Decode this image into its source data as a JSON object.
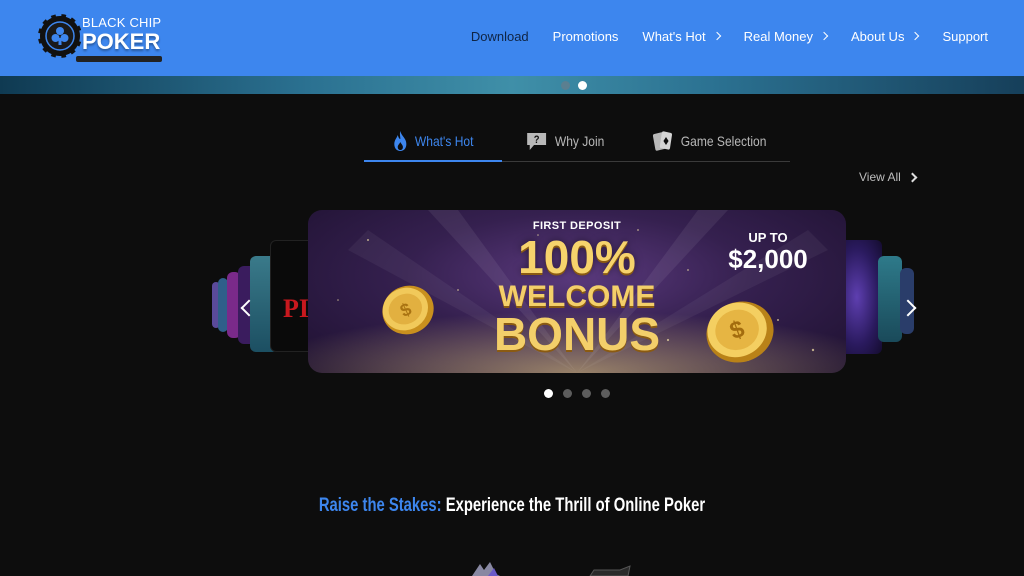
{
  "header": {
    "logo": {
      "top_text": "BLACK CHIP",
      "bottom_text": "POKER"
    },
    "nav": [
      {
        "label": "Download",
        "has_chevron": false
      },
      {
        "label": "Promotions",
        "has_chevron": false
      },
      {
        "label": "What's Hot",
        "has_chevron": true
      },
      {
        "label": "Real Money",
        "has_chevron": true
      },
      {
        "label": "About Us",
        "has_chevron": true
      },
      {
        "label": "Support",
        "has_chevron": false
      }
    ],
    "accent_color": "#3d86ee"
  },
  "hero": {
    "dots": 2,
    "active_dot": 2
  },
  "tabs": [
    {
      "label": "What's Hot",
      "icon": "flame-icon",
      "active": true
    },
    {
      "label": "Why Join",
      "icon": "question-bubble-icon",
      "active": false
    },
    {
      "label": "Game Selection",
      "icon": "playing-cards-icon",
      "active": false
    }
  ],
  "view_all": {
    "label": "View All"
  },
  "promo": {
    "first_deposit": "FIRST DEPOSIT",
    "percent": "100%",
    "welcome": "WELCOME",
    "bonus": "BONUS",
    "up_to": "UP TO",
    "amount": "$2,000"
  },
  "carousel": {
    "dots": 4,
    "active_dot": 1
  },
  "headline": {
    "part_a": "Raise the Stakes:",
    "part_b": "Experience the Thrill of Online Poker"
  }
}
